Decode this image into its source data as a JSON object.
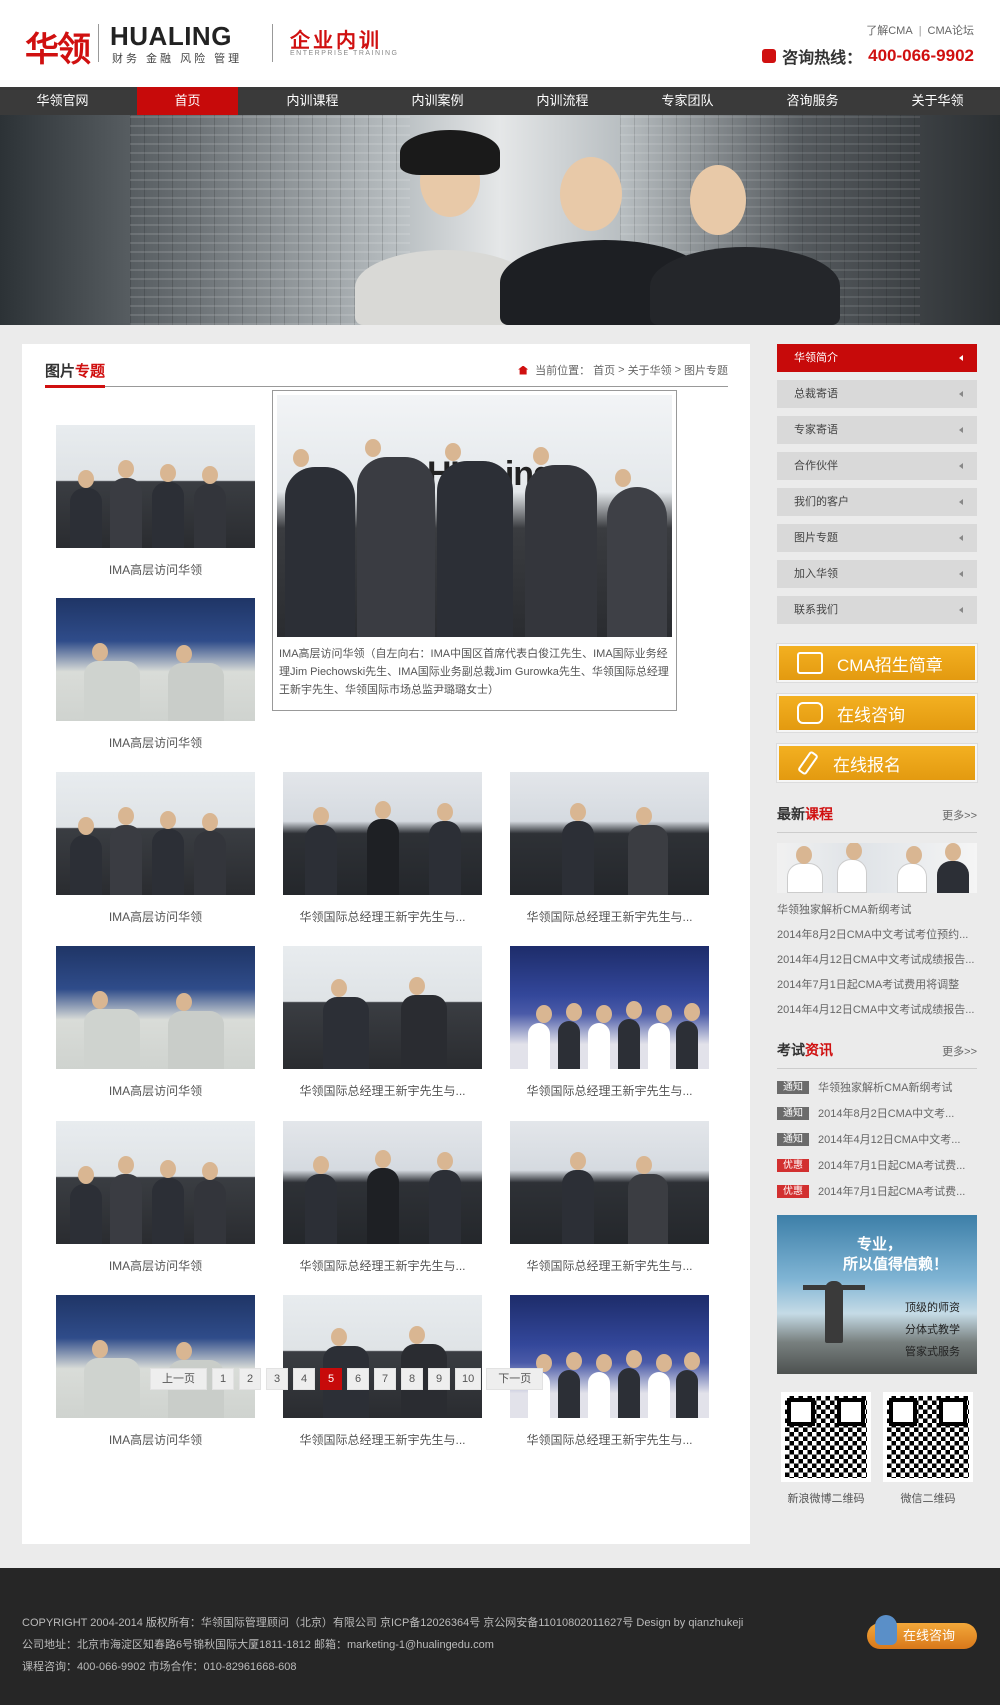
{
  "header": {
    "logo_cn": "华领",
    "logo_en": "HUALING",
    "logo_sub": "财务 金融 风险 管理",
    "logo_tr": "企业内训",
    "logo_tr_en": "ENTERPRISE TRAINING",
    "link1": "了解CMA",
    "sep": "|",
    "link2": "CMA论坛",
    "hotline_label": "咨询热线：",
    "hotline_num": "400-066-9902"
  },
  "nav": [
    "华领官网",
    "首页",
    "内训课程",
    "内训案例",
    "内训流程",
    "专家团队",
    "咨询服务",
    "关于华领"
  ],
  "main": {
    "title_a": "图片",
    "title_b": "专题",
    "crumb": [
      "当前位置：",
      "首页",
      ">",
      "关于华领",
      ">",
      "图片专题"
    ],
    "popup_text": "IMA高层访问华领（自左向右：IMA中国区首席代表白俊江先生、IMA国际业务经理Jim Piechowski先生、IMA国际业务副总裁Jim Gurowka先生、华领国际总经理王新宇先生、华领国际市场总监尹璐璐女士）",
    "popup_sign": "HUA ing",
    "items": [
      "IMA高层访问华领",
      "IMA高层访问华领",
      "IMA高层访问华领",
      "华领国际总经理王新宇先生与...",
      "华领国际总经理王新宇先生与...",
      "IMA高层访问华领",
      "华领国际总经理王新宇先生与...",
      "华领国际总经理王新宇先生与...",
      "IMA高层访问华领",
      "华领国际总经理王新宇先生与...",
      "华领国际总经理王新宇先生与...",
      "IMA高层访问华领",
      "华领国际总经理王新宇先生与...",
      "华领国际总经理王新宇先生与..."
    ],
    "pager": [
      "上一页",
      "1",
      "2",
      "3",
      "4",
      "5",
      "6",
      "7",
      "8",
      "9",
      "10",
      "下一页"
    ],
    "current_page": "5"
  },
  "side": {
    "menu": [
      "华领简介",
      "总裁寄语",
      "专家寄语",
      "合作伙伴",
      "我们的客户",
      "图片专题",
      "加入华领",
      "联系我们"
    ],
    "buttons": [
      "CMA招生简章",
      "在线咨询",
      "在线报名"
    ],
    "course_title_a": "最新",
    "course_title_b": "课程",
    "more": "更多>>",
    "courses": [
      "华领独家解析CMA新纲考试",
      "2014年8月2日CMA中文考试考位预约...",
      "2014年4月12日CMA中文考试成绩报告...",
      "2014年7月1日起CMA考试费用将调整",
      "2014年4月12日CMA中文考试成绩报告..."
    ],
    "news_title_a": "考试",
    "news_title_b": "资讯",
    "news": [
      {
        "tag": "通知",
        "text": "华领独家解析CMA新纲考试",
        "color": "gray"
      },
      {
        "tag": "通知",
        "text": "2014年8月2日CMA中文考...",
        "color": "gray"
      },
      {
        "tag": "通知",
        "text": "2014年4月12日CMA中文考...",
        "color": "gray"
      },
      {
        "tag": "优惠",
        "text": "2014年7月1日起CMA考试费...",
        "color": "red"
      },
      {
        "tag": "优惠",
        "text": "2014年7月1日起CMA考试费...",
        "color": "red"
      }
    ],
    "ad": {
      "l1": "专业，",
      "l2": "所以值得信赖！",
      "l3": "顶级的师资",
      "l4": "分体式教学",
      "l5": "管家式服务"
    },
    "qr": [
      "新浪微博二维码",
      "微信二维码"
    ]
  },
  "footer": {
    "line1": "COPYRIGHT  2004-2014 版权所有：华领国际管理顾问（北京）有限公司 京ICP备12026364号 京公网安备11010802011627号    Design by qianzhukeji",
    "line2": "公司地址：北京市海淀区知春路6号锦秋国际大厦1811-1812    邮箱：marketing-1@hualingedu.com",
    "line3": "课程咨询：400-066-9902    市场合作：010-82961668-608",
    "chat_btn": "在线咨询"
  },
  "colors": {
    "brand_red": "#c70a0a",
    "nav_bg": "#3a3a3a",
    "gold": "#e8a015",
    "footer": "#262626"
  }
}
